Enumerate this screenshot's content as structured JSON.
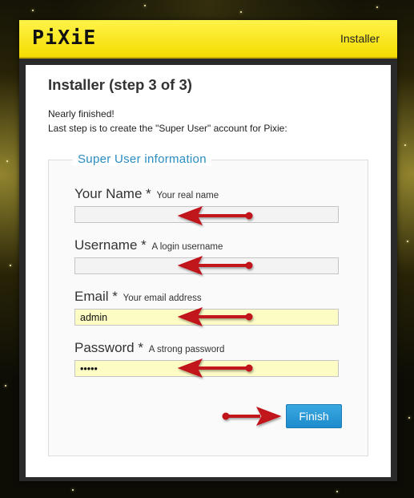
{
  "header": {
    "logo_text": "PiXiE",
    "nav_link": "Installer"
  },
  "page": {
    "title": "Installer (step 3 of 3)",
    "intro_line1": "Nearly finished!",
    "intro_line2": "Last step is to create the \"Super User\" account for Pixie:"
  },
  "form": {
    "legend": "Super User information",
    "required_marker": "*",
    "fields": [
      {
        "label": "Your Name",
        "hint": "Your real name",
        "value": ""
      },
      {
        "label": "Username",
        "hint": "A login username",
        "value": ""
      },
      {
        "label": "Email",
        "hint": "Your email address",
        "value": "admin"
      },
      {
        "label": "Password",
        "hint": "A strong password",
        "value": "•••••"
      }
    ],
    "submit_label": "Finish"
  },
  "colors": {
    "header_yellow": "#f4dc00",
    "legend_blue": "#2a8cc2",
    "button_blue": "#1e8ccc",
    "arrow_red": "#c0121a",
    "filled_input": "#fcfcc4"
  }
}
